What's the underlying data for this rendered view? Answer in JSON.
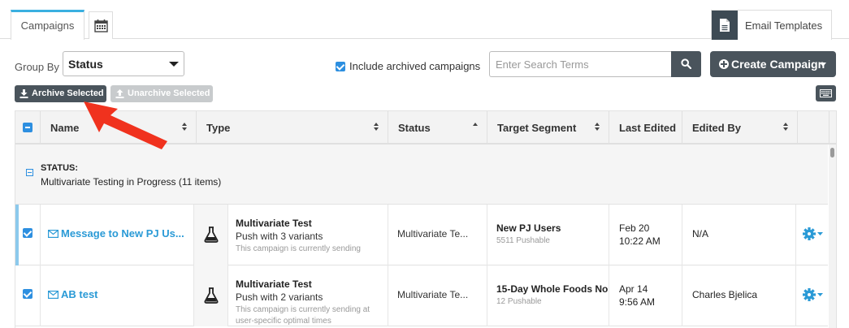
{
  "tabs": {
    "campaigns_label": "Campaigns",
    "calendar_icon": "calendar-icon",
    "email_templates_label": "Email Templates"
  },
  "toolbar": {
    "group_by_label": "Group By",
    "group_by_value": "Status",
    "include_archived_label": "Include archived campaigns",
    "include_archived_checked": true,
    "search_placeholder": "Enter Search Terms",
    "create_label": "Create Campaign",
    "archive_label": "Archive Selected",
    "unarchive_label": "Unarchive Selected"
  },
  "table": {
    "columns": [
      "Name",
      "Type",
      "Status",
      "Target Segment",
      "Last Edited",
      "Edited By"
    ],
    "group": {
      "title": "STATUS:",
      "subtitle": "Multivariate Testing in Progress (11 items)"
    },
    "rows": [
      {
        "name": "Message to New PJ Us...",
        "type_title": "Multivariate Test",
        "type_sub": "Push with 3 variants",
        "type_note": "This campaign is currently sending",
        "status": "Multivariate Te...",
        "segment": "New PJ Users",
        "segment_sub": "5511 Pushable",
        "edited_date": "Feb 20",
        "edited_time": "10:22 AM",
        "edited_by": "N/A"
      },
      {
        "name": "AB test",
        "type_title": "Multivariate Test",
        "type_sub": "Push with 2 variants",
        "type_note": "This campaign is currently sending at user-specific optimal times",
        "status": "Multivariate Te...",
        "segment": "15-Day Whole Foods No",
        "segment_sub": "12 Pushable",
        "edited_date": "Apr 14",
        "edited_time": "9:56 AM",
        "edited_by": "Charles Bjelica"
      }
    ]
  },
  "colors": {
    "accent_blue": "#2d8fe0",
    "link_blue": "#2a9ad6",
    "dark_button": "#4a545c",
    "annotation_red": "#f0321e"
  }
}
